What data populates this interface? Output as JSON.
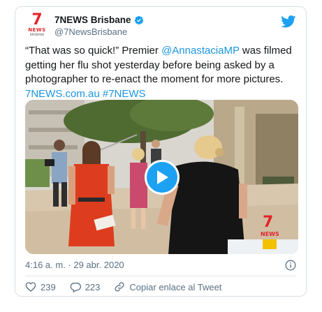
{
  "account": {
    "display_name": "7NEWS Brisbane",
    "handle": "@7NewsBrisbane",
    "avatar": {
      "numeral": "7",
      "word": "NEWS",
      "city": "BRISBANE"
    },
    "verified": true
  },
  "tweet": {
    "text_parts": [
      "“That was so quick!” Premier ",
      "@AnnastaciaMP",
      " was filmed getting her flu shot yesterday before being asked by a photographer to re-enact the moment for more pictures. ",
      "7NEWS.com.au",
      " ",
      "#7NEWS"
    ]
  },
  "media": {
    "type": "video",
    "watermark": "7",
    "watermark_sub": "NEWS"
  },
  "meta": {
    "timestamp": "4:16 a. m. · 29 abr. 2020"
  },
  "actions": {
    "likes": "239",
    "replies": "223",
    "copy_link": "Copiar enlace al Tweet"
  },
  "colors": {
    "link": "#1b95e0",
    "brand_red": "#e1252b",
    "twitter_blue": "#1da1f2",
    "secondary_text": "#5b7083"
  },
  "icons": [
    "verified-badge-icon",
    "twitter-bird-icon",
    "play-icon",
    "info-icon",
    "heart-icon",
    "reply-icon",
    "link-icon"
  ]
}
